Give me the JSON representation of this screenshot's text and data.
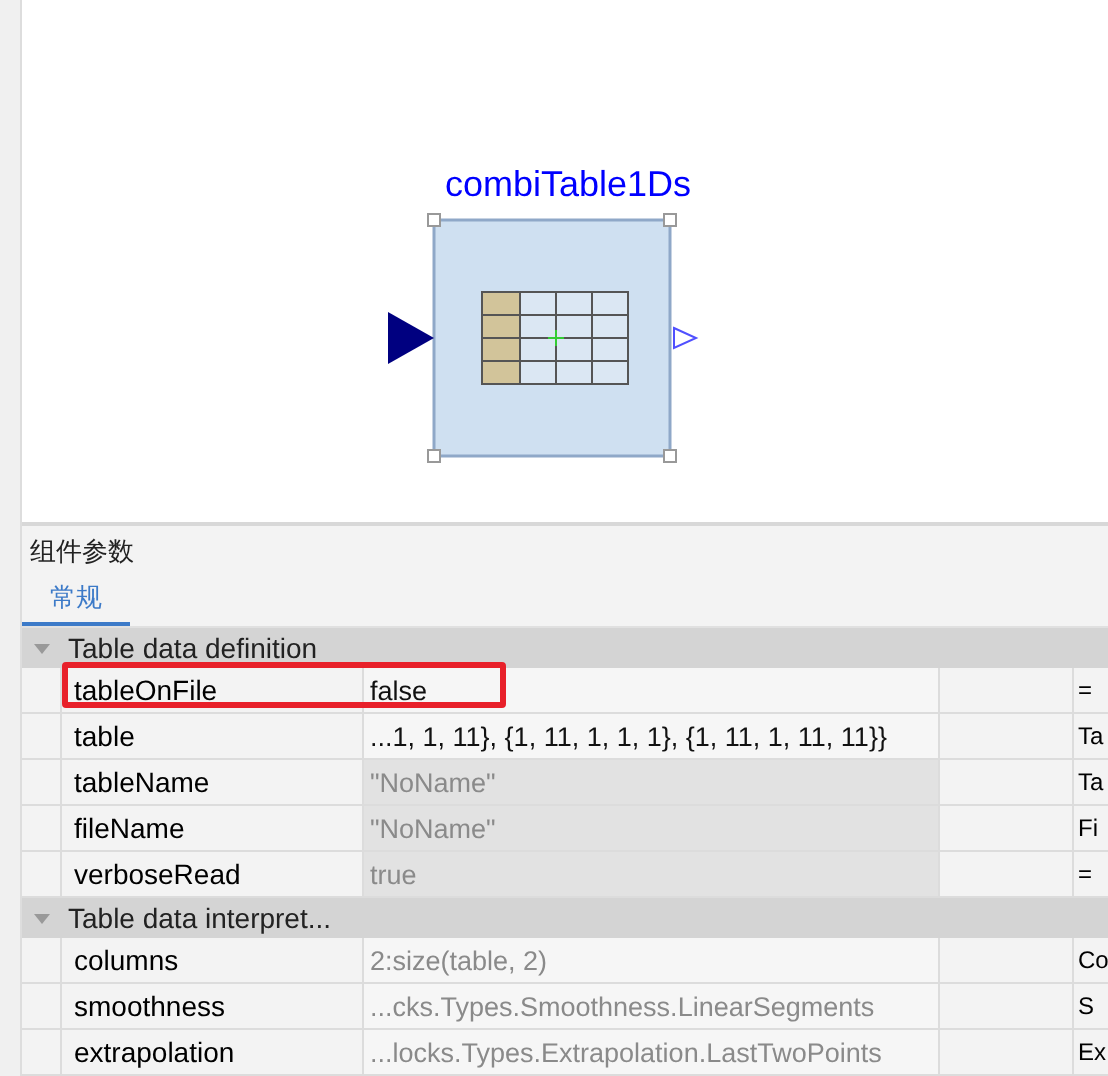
{
  "diagram": {
    "block": {
      "label": "combiTable1Ds",
      "selected": true
    }
  },
  "panel": {
    "title": "组件参数",
    "tabs": [
      {
        "label": "常规",
        "selected": true
      }
    ]
  },
  "groups": [
    {
      "title": "Table data definition",
      "expanded": true,
      "rows": [
        {
          "name": "tableOnFile",
          "value": "false",
          "muted": false,
          "disabled": false,
          "highlighted": true,
          "description": "="
        },
        {
          "name": "table",
          "value": "...1, 1, 11}, {1, 11, 1, 1, 1}, {1, 11, 1, 11, 11}}",
          "muted": false,
          "disabled": false,
          "description": "Ta"
        },
        {
          "name": "tableName",
          "value": "\"NoName\"",
          "muted": true,
          "disabled": true,
          "description": "Ta"
        },
        {
          "name": "fileName",
          "value": "\"NoName\"",
          "muted": true,
          "disabled": true,
          "description": "Fi"
        },
        {
          "name": "verboseRead",
          "value": "true",
          "muted": true,
          "disabled": true,
          "description": "="
        }
      ]
    },
    {
      "title": "Table data interpret...",
      "expanded": true,
      "rows": [
        {
          "name": "columns",
          "value": "2:size(table, 2)",
          "muted": true,
          "disabled": false,
          "description": "Co"
        },
        {
          "name": "smoothness",
          "value": "...cks.Types.Smoothness.LinearSegments",
          "muted": true,
          "disabled": false,
          "description": "S"
        },
        {
          "name": "extrapolation",
          "value": "...locks.Types.Extrapolation.LastTwoPoints",
          "muted": true,
          "disabled": false,
          "description": "Ex"
        }
      ]
    }
  ]
}
